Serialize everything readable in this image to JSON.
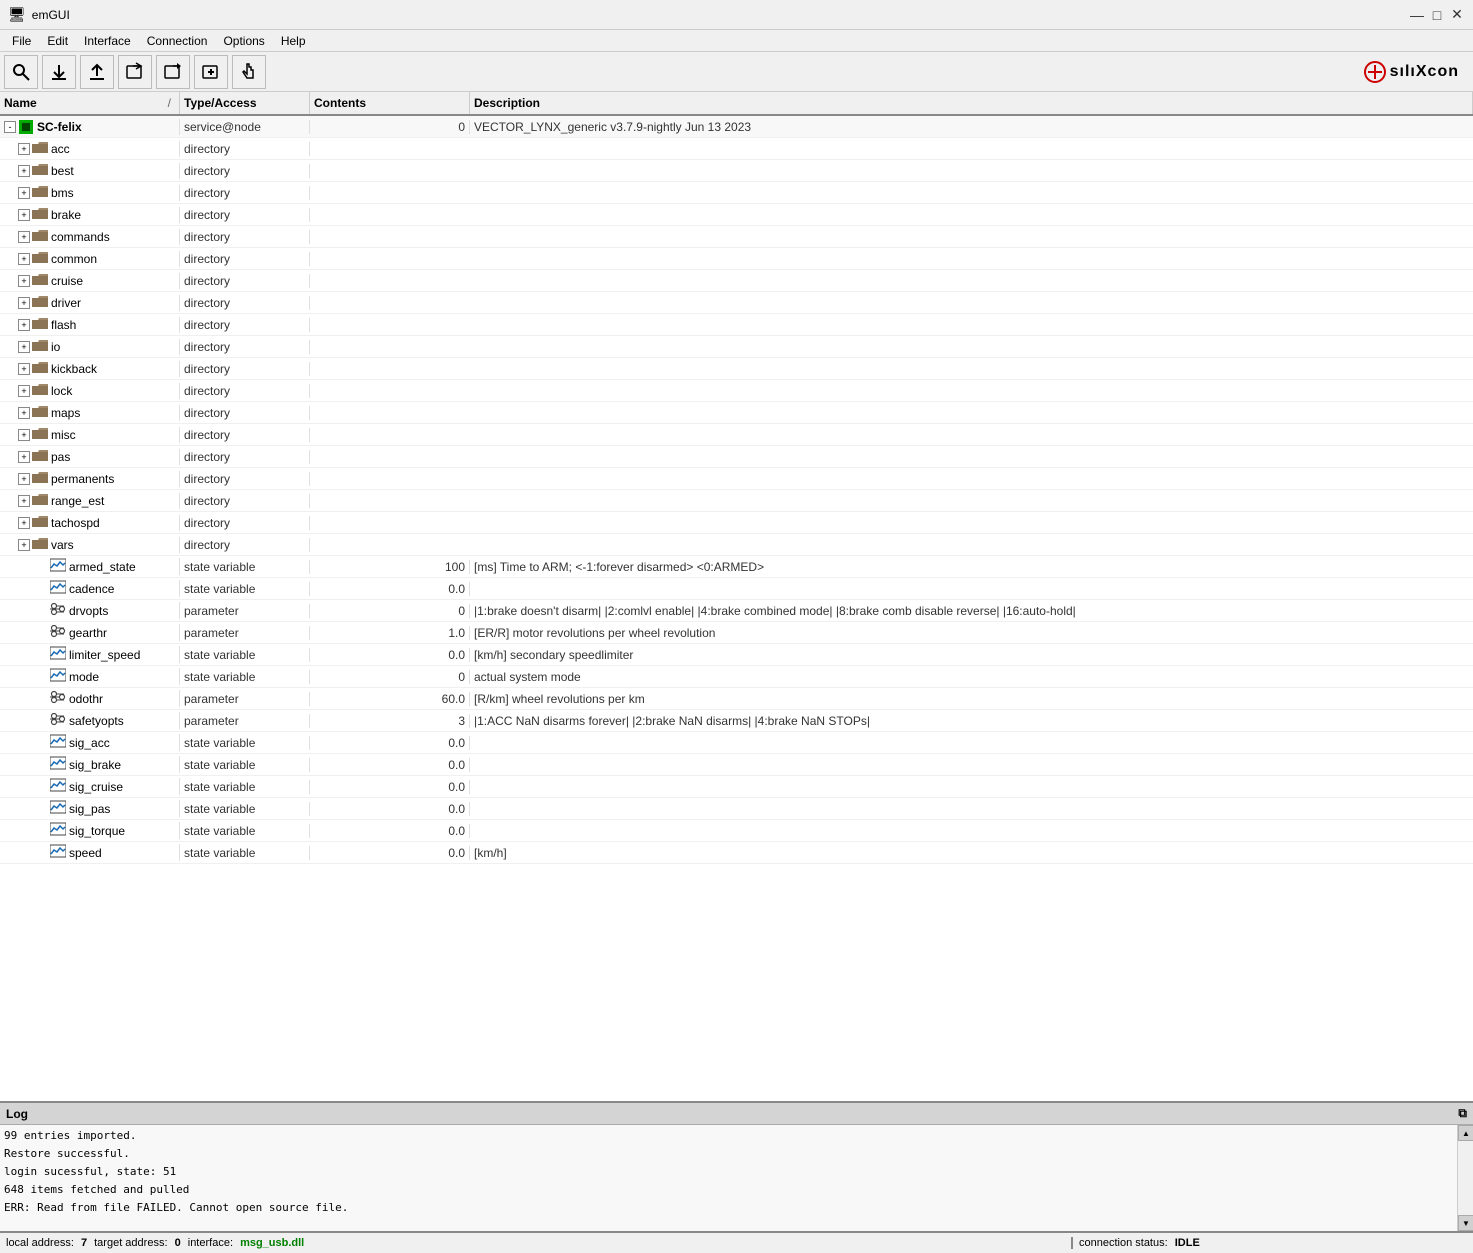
{
  "app": {
    "title": "emGUI",
    "logo_text": "sılıXcon"
  },
  "titlebar": {
    "minimize": "—",
    "maximize": "□",
    "close": "✕"
  },
  "menu": {
    "items": [
      "File",
      "Edit",
      "Interface",
      "Connection",
      "Options",
      "Help"
    ]
  },
  "toolbar": {
    "buttons": [
      {
        "icon": "🔍",
        "name": "search-btn",
        "label": "Search"
      },
      {
        "icon": "⬇",
        "name": "download-btn",
        "label": "Download"
      },
      {
        "icon": "⬆",
        "name": "upload-btn",
        "label": "Upload"
      },
      {
        "icon": "📤",
        "name": "export-btn",
        "label": "Export"
      },
      {
        "icon": "📥",
        "name": "import-btn",
        "label": "Import"
      },
      {
        "icon": "➕",
        "name": "add-btn",
        "label": "Add"
      },
      {
        "icon": "👆",
        "name": "pointer-btn",
        "label": "Pointer"
      }
    ]
  },
  "columns": {
    "name": "Name",
    "sort_indicator": "/",
    "type_access": "Type/Access",
    "contents": "Contents",
    "description": "Description"
  },
  "tree": {
    "root": {
      "name": "SC-felix",
      "type": "service@node",
      "contents": "0",
      "description": "VECTOR_LYNX_generic v3.7.9-nightly Jun 13 2023",
      "children": [
        {
          "name": "acc",
          "type": "directory",
          "contents": "",
          "description": "",
          "icon": "folder"
        },
        {
          "name": "best",
          "type": "directory",
          "contents": "",
          "description": "",
          "icon": "folder"
        },
        {
          "name": "bms",
          "type": "directory",
          "contents": "",
          "description": "",
          "icon": "folder"
        },
        {
          "name": "brake",
          "type": "directory",
          "contents": "",
          "description": "",
          "icon": "folder"
        },
        {
          "name": "commands",
          "type": "directory",
          "contents": "",
          "description": "",
          "icon": "folder"
        },
        {
          "name": "common",
          "type": "directory",
          "contents": "",
          "description": "",
          "icon": "folder"
        },
        {
          "name": "cruise",
          "type": "directory",
          "contents": "",
          "description": "",
          "icon": "folder"
        },
        {
          "name": "driver",
          "type": "directory",
          "contents": "",
          "description": "",
          "icon": "folder"
        },
        {
          "name": "flash",
          "type": "directory",
          "contents": "",
          "description": "",
          "icon": "folder"
        },
        {
          "name": "io",
          "type": "directory",
          "contents": "",
          "description": "",
          "icon": "folder"
        },
        {
          "name": "kickback",
          "type": "directory",
          "contents": "",
          "description": "",
          "icon": "folder"
        },
        {
          "name": "lock",
          "type": "directory",
          "contents": "",
          "description": "",
          "icon": "folder"
        },
        {
          "name": "maps",
          "type": "directory",
          "contents": "",
          "description": "",
          "icon": "folder"
        },
        {
          "name": "misc",
          "type": "directory",
          "contents": "",
          "description": "",
          "icon": "folder"
        },
        {
          "name": "pas",
          "type": "directory",
          "contents": "",
          "description": "",
          "icon": "folder"
        },
        {
          "name": "permanents",
          "type": "directory",
          "contents": "",
          "description": "",
          "icon": "folder"
        },
        {
          "name": "range_est",
          "type": "directory",
          "contents": "",
          "description": "",
          "icon": "folder"
        },
        {
          "name": "tachospd",
          "type": "directory",
          "contents": "",
          "description": "",
          "icon": "folder"
        },
        {
          "name": "vars",
          "type": "directory",
          "contents": "",
          "description": "",
          "icon": "folder"
        },
        {
          "name": "armed_state",
          "type": "state variable",
          "contents": "100",
          "description": "[ms] Time to ARM; <-1:forever disarmed> <0:ARMED>",
          "icon": "state"
        },
        {
          "name": "cadence",
          "type": "state variable",
          "contents": "0.0",
          "description": "",
          "icon": "state"
        },
        {
          "name": "drvopts",
          "type": "parameter",
          "contents": "0",
          "description": "|1:brake doesn't disarm| |2:comlvl enable| |4:brake combined mode| |8:brake comb disable reverse| |16:auto-hold|",
          "icon": "param"
        },
        {
          "name": "gearthr",
          "type": "parameter",
          "contents": "1.0",
          "description": "[ER/R] motor revolutions per wheel revolution",
          "icon": "param"
        },
        {
          "name": "limiter_speed",
          "type": "state variable",
          "contents": "0.0",
          "description": "[km/h] secondary speedlimiter",
          "icon": "state"
        },
        {
          "name": "mode",
          "type": "state variable",
          "contents": "0",
          "description": "actual system mode",
          "icon": "state"
        },
        {
          "name": "odothr",
          "type": "parameter",
          "contents": "60.0",
          "description": "[R/km] wheel revolutions per km",
          "icon": "param"
        },
        {
          "name": "safetyopts",
          "type": "parameter",
          "contents": "3",
          "description": "|1:ACC NaN disarms forever| |2:brake NaN disarms| |4:brake NaN STOPs|",
          "icon": "param"
        },
        {
          "name": "sig_acc",
          "type": "state variable",
          "contents": "0.0",
          "description": "",
          "icon": "state"
        },
        {
          "name": "sig_brake",
          "type": "state variable",
          "contents": "0.0",
          "description": "",
          "icon": "state"
        },
        {
          "name": "sig_cruise",
          "type": "state variable",
          "contents": "0.0",
          "description": "",
          "icon": "state"
        },
        {
          "name": "sig_pas",
          "type": "state variable",
          "contents": "0.0",
          "description": "",
          "icon": "state"
        },
        {
          "name": "sig_torque",
          "type": "state variable",
          "contents": "0.0",
          "description": "",
          "icon": "state"
        },
        {
          "name": "speed",
          "type": "state variable",
          "contents": "0.0",
          "description": "[km/h]",
          "icon": "state"
        }
      ]
    }
  },
  "log": {
    "title": "Log",
    "entries": [
      "99 entries imported.",
      "Restore successful.",
      "login sucessful, state: 51",
      "648 items fetched and pulled",
      "ERR: Read from file FAILED. Cannot open source file."
    ]
  },
  "statusbar": {
    "local_label": "local address:",
    "local_value": "7",
    "target_label": "target address:",
    "target_value": "0",
    "interface_label": "interface:",
    "interface_value": "msg_usb.dll",
    "connection_label": "connection status:",
    "connection_value": "IDLE"
  }
}
